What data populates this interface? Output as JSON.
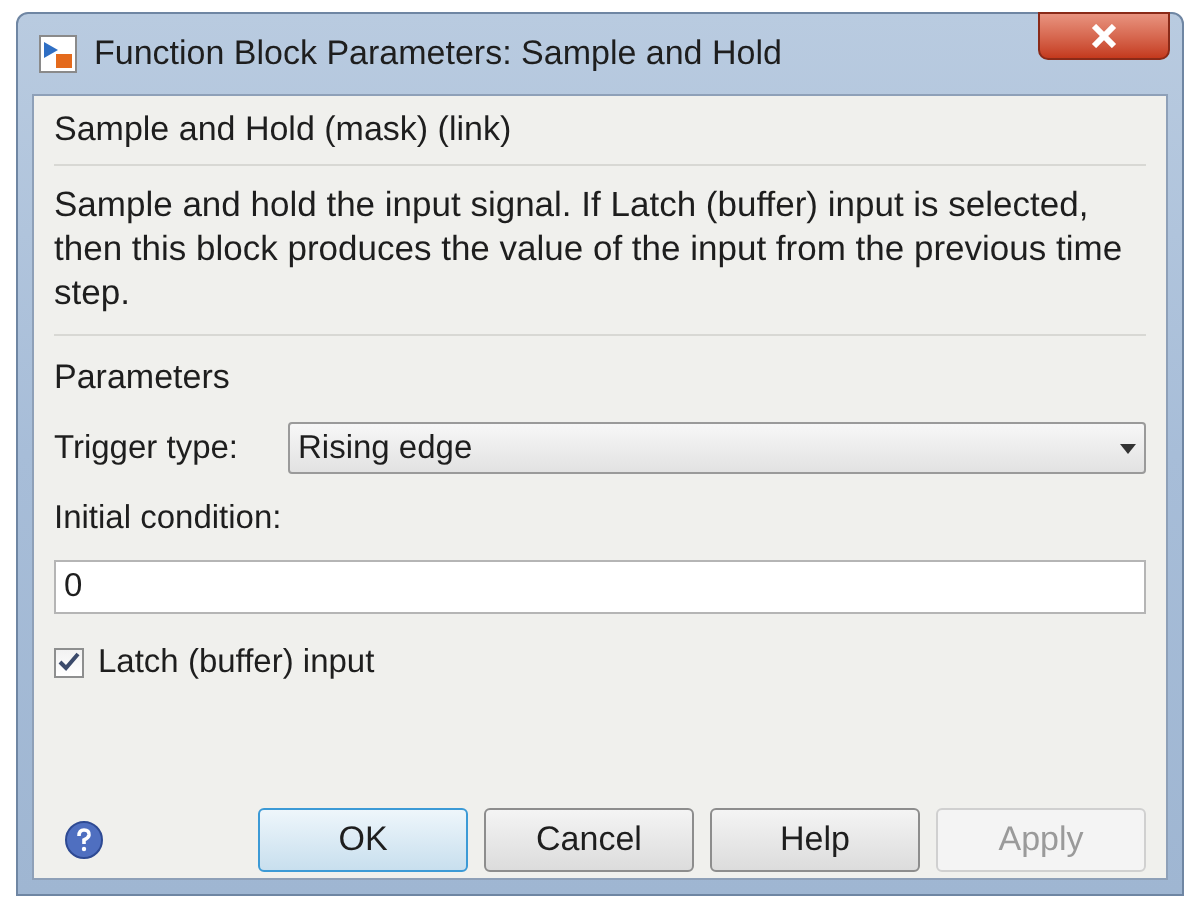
{
  "window": {
    "title": "Function Block Parameters: Sample and Hold"
  },
  "block": {
    "heading": "Sample and Hold (mask) (link)",
    "description": "Sample and hold the input signal. If Latch (buffer) input is selected, then this block produces the value of the input from the previous time step."
  },
  "parameters": {
    "heading": "Parameters",
    "trigger_type": {
      "label": "Trigger type:",
      "value": "Rising edge"
    },
    "initial_condition": {
      "label": "Initial condition:",
      "value": "0"
    },
    "latch": {
      "label": "Latch (buffer) input",
      "checked": true
    }
  },
  "buttons": [
    {
      "label": "OK",
      "default": true,
      "disabled": false
    },
    {
      "label": "Cancel",
      "default": false,
      "disabled": false
    },
    {
      "label": "Help",
      "default": false,
      "disabled": false
    },
    {
      "label": "Apply",
      "default": false,
      "disabled": true
    }
  ]
}
